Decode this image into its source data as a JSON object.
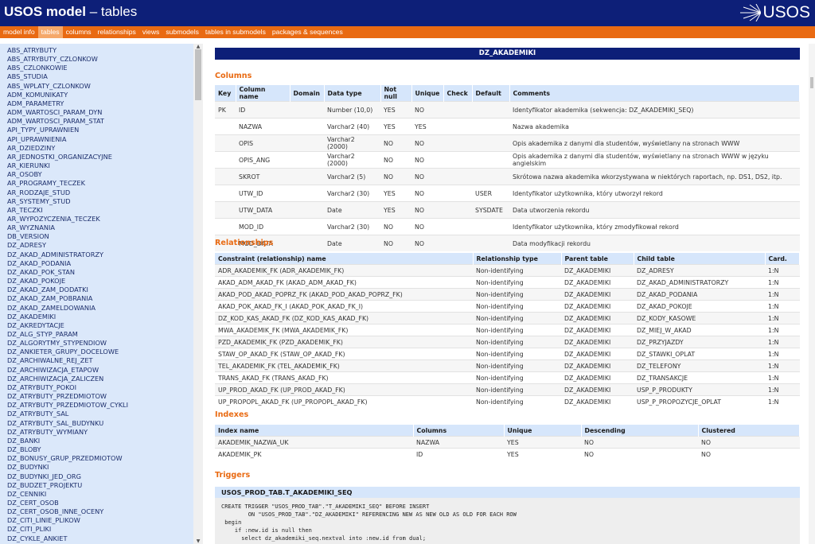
{
  "header": {
    "title_bold": "USOS model",
    "title_dash": " – ",
    "title_rest": "tables",
    "logo_text": "USOS"
  },
  "nav": {
    "items": [
      "model info",
      "tables",
      "columns",
      "relationships",
      "views",
      "submodels",
      "tables in submodels",
      "packages & sequences"
    ],
    "active": "tables"
  },
  "sidebar": {
    "items": [
      "ABS_ATRYBUTY",
      "ABS_ATRYBUTY_CZLONKOW",
      "ABS_CZLONKOWIE",
      "ABS_STUDIA",
      "ABS_WPLATY_CZLONKOW",
      "ADM_KOMUNIKATY",
      "ADM_PARAMETRY",
      "ADM_WARTOSCI_PARAM_DYN",
      "ADM_WARTOSCI_PARAM_STAT",
      "API_TYPY_UPRAWNIEN",
      "API_UPRAWNIENIA",
      "AR_DZIEDZINY",
      "AR_JEDNOSTKI_ORGANIZACYJNE",
      "AR_KIERUNKI",
      "AR_OSOBY",
      "AR_PROGRAMY_TECZEK",
      "AR_RODZAJE_STUD",
      "AR_SYSTEMY_STUD",
      "AR_TECZKI",
      "AR_WYPOZYCZENIA_TECZEK",
      "AR_WYZNANIA",
      "DB_VERSION",
      "DZ_ADRESY",
      "DZ_AKAD_ADMINISTRATORZY",
      "DZ_AKAD_PODANIA",
      "DZ_AKAD_POK_STAN",
      "DZ_AKAD_POKOJE",
      "DZ_AKAD_ZAM_DODATKI",
      "DZ_AKAD_ZAM_POBRANIA",
      "DZ_AKAD_ZAMELDOWANIA",
      "DZ_AKADEMIKI",
      "DZ_AKREDYTACJE",
      "DZ_ALG_STYP_PARAM",
      "DZ_ALGORYTMY_STYPENDIOW",
      "DZ_ANKIETER_GRUPY_DOCELOWE",
      "DZ_ARCHIWALNE_REJ_ZET",
      "DZ_ARCHIWIZACJA_ETAPOW",
      "DZ_ARCHIWIZACJA_ZALICZEN",
      "DZ_ATRYBUTY_POKOI",
      "DZ_ATRYBUTY_PRZEDMIOTOW",
      "DZ_ATRYBUTY_PRZEDMIOTOW_CYKLI",
      "DZ_ATRYBUTY_SAL",
      "DZ_ATRYBUTY_SAL_BUDYNKU",
      "DZ_ATRYBUTY_WYMIANY",
      "DZ_BANKI",
      "DZ_BLOBY",
      "DZ_BONUSY_GRUP_PRZEDMIOTOW",
      "DZ_BUDYNKI",
      "DZ_BUDYNKI_JED_ORG",
      "DZ_BUDZET_PROJEKTU",
      "DZ_CENNIKI",
      "DZ_CERT_OSOB",
      "DZ_CERT_OSOB_INNE_OCENY",
      "DZ_CITI_LINIE_PLIKOW",
      "DZ_CITI_PLIKI",
      "DZ_CYKLE_ANKIET"
    ]
  },
  "main": {
    "table_name": "DZ_AKADEMIKI",
    "columns_title": "Columns",
    "columns_headers": [
      "Key",
      "Column name",
      "Domain",
      "Data type",
      "Not null",
      "Unique",
      "Check",
      "Default",
      "Comments"
    ],
    "columns_rows": [
      [
        "PK",
        "ID",
        "",
        "Number (10,0)",
        "YES",
        "NO",
        "",
        "",
        "Identyfikator akademika (sekwencja: DZ_AKADEMIKI_SEQ)"
      ],
      [
        "",
        "NAZWA",
        "",
        "Varchar2 (40)",
        "YES",
        "YES",
        "",
        "",
        "Nazwa akademika"
      ],
      [
        "",
        "OPIS",
        "",
        "Varchar2 (2000)",
        "NO",
        "NO",
        "",
        "",
        "Opis akademika z danymi dla studentów, wyświetlany na stronach WWW"
      ],
      [
        "",
        "OPIS_ANG",
        "",
        "Varchar2 (2000)",
        "NO",
        "NO",
        "",
        "",
        "Opis akademika z danymi dla studentów, wyświetlany na stronach WWW w języku angielskim"
      ],
      [
        "",
        "SKROT",
        "",
        "Varchar2 (5)",
        "NO",
        "NO",
        "",
        "",
        "Skrótowa nazwa akademika wkorzystywana w niektórych raportach, np. DS1, DS2, itp."
      ],
      [
        "",
        "UTW_ID",
        "",
        "Varchar2 (30)",
        "YES",
        "NO",
        "",
        "USER",
        "Identyfikator użytkownika, który utworzył rekord"
      ],
      [
        "",
        "UTW_DATA",
        "",
        "Date",
        "YES",
        "NO",
        "",
        "SYSDATE",
        "Data utworzenia rekordu"
      ],
      [
        "",
        "MOD_ID",
        "",
        "Varchar2 (30)",
        "NO",
        "NO",
        "",
        "",
        "Identyfikator użytkownika, który zmodyfikował rekord"
      ],
      [
        "",
        "MOD_DATA",
        "",
        "Date",
        "NO",
        "NO",
        "",
        "",
        "Data modyfikacji rekordu"
      ]
    ],
    "relationships_title": "Relationships",
    "relationships_headers": [
      "Constraint (relationship) name",
      "Relationship type",
      "Parent table",
      "Child table",
      "Card."
    ],
    "relationships_rows": [
      [
        "ADR_AKADEMIK_FK (ADR_AKADEMIK_FK)",
        "Non-identifying",
        "DZ_AKADEMIKI",
        "DZ_ADRESY",
        "1:N"
      ],
      [
        "AKAD_ADM_AKAD_FK (AKAD_ADM_AKAD_FK)",
        "Non-identifying",
        "DZ_AKADEMIKI",
        "DZ_AKAD_ADMINISTRATORZY",
        "1:N"
      ],
      [
        "AKAD_POD_AKAD_POPRZ_FK (AKAD_POD_AKAD_POPRZ_FK)",
        "Non-identifying",
        "DZ_AKADEMIKI",
        "DZ_AKAD_PODANIA",
        "1:N"
      ],
      [
        "AKAD_POK_AKAD_FK_I (AKAD_POK_AKAD_FK_I)",
        "Non-identifying",
        "DZ_AKADEMIKI",
        "DZ_AKAD_POKOJE",
        "1:N"
      ],
      [
        "DZ_KOD_KAS_AKAD_FK (DZ_KOD_KAS_AKAD_FK)",
        "Non-identifying",
        "DZ_AKADEMIKI",
        "DZ_KODY_KASOWE",
        "1:N"
      ],
      [
        "MWA_AKADEMIK_FK (MWA_AKADEMIK_FK)",
        "Non-identifying",
        "DZ_AKADEMIKI",
        "DZ_MIEJ_W_AKAD",
        "1:N"
      ],
      [
        "PZD_AKADEMIK_FK (PZD_AKADEMIK_FK)",
        "Non-identifying",
        "DZ_AKADEMIKI",
        "DZ_PRZYJAZDY",
        "1:N"
      ],
      [
        "STAW_OP_AKAD_FK (STAW_OP_AKAD_FK)",
        "Non-identifying",
        "DZ_AKADEMIKI",
        "DZ_STAWKI_OPLAT",
        "1:N"
      ],
      [
        "TEL_AKADEMIK_FK (TEL_AKADEMIK_FK)",
        "Non-identifying",
        "DZ_AKADEMIKI",
        "DZ_TELEFONY",
        "1:N"
      ],
      [
        "TRANS_AKAD_FK (TRANS_AKAD_FK)",
        "Non-identifying",
        "DZ_AKADEMIKI",
        "DZ_TRANSAKCJE",
        "1:N"
      ],
      [
        "UP_PROD_AKAD_FK (UP_PROD_AKAD_FK)",
        "Non-identifying",
        "DZ_AKADEMIKI",
        "USP_P_PRODUKTY",
        "1:N"
      ],
      [
        "UP_PROPOPL_AKAD_FK (UP_PROPOPL_AKAD_FK)",
        "Non-identifying",
        "DZ_AKADEMIKI",
        "USP_P_PROPOZYCJE_OPLAT",
        "1:N"
      ]
    ],
    "indexes_title": "Indexes",
    "indexes_headers": [
      "Index name",
      "Columns",
      "Unique",
      "Descending",
      "Clustered"
    ],
    "indexes_rows": [
      [
        "AKADEMIK_NAZWA_UK",
        "NAZWA",
        "YES",
        "NO",
        "NO"
      ],
      [
        "AKADEMIK_PK",
        "ID",
        "YES",
        "NO",
        "NO"
      ]
    ],
    "triggers_title": "Triggers",
    "trigger_name": "USOS_PROD_TAB.T_AKADEMIKI_SEQ",
    "trigger_code": "CREATE TRIGGER \"USOS_PROD_TAB\".\"T_AKADEMIKI_SEQ\" BEFORE INSERT\n        ON \"USOS_PROD_TAB\".\"DZ_AKADEMIKI\" REFERENCING NEW AS NEW OLD AS OLD FOR EACH ROW\n begin\n    if :new.id is null then\n      select dz_akademiki_seq.nextval into :new.id from dual;"
  }
}
